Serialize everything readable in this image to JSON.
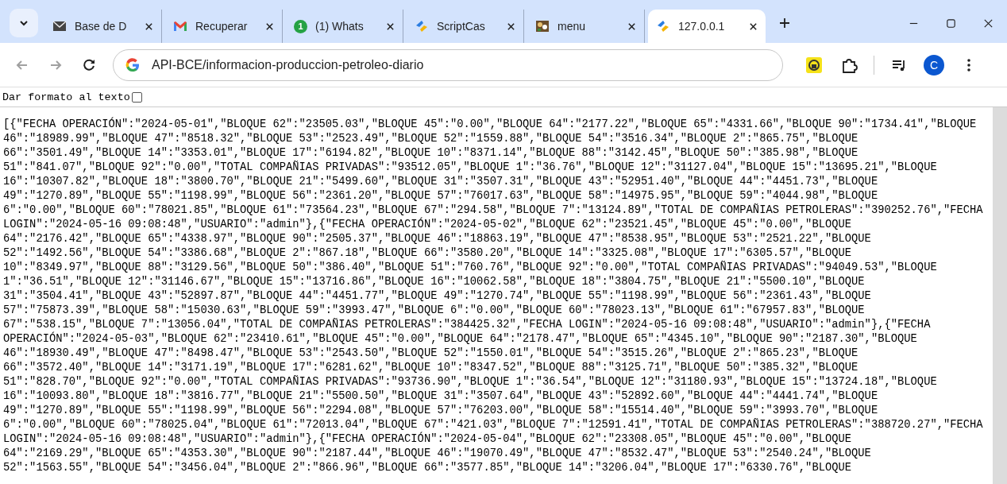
{
  "tabs": [
    {
      "kind": "mail",
      "title": "Base de D",
      "selected": false
    },
    {
      "kind": "gmail",
      "title": "Recuperar",
      "selected": false
    },
    {
      "kind": "whatsapp",
      "title": "(1) Whats",
      "badge": "1",
      "selected": false
    },
    {
      "kind": "scriptcase",
      "title": "ScriptCas",
      "selected": false
    },
    {
      "kind": "image",
      "title": "menu",
      "selected": false
    },
    {
      "kind": "scriptcase",
      "title": "127.0.0.1",
      "selected": true
    }
  ],
  "address": "API-BCE/informacion-produccion-petroleo-diario",
  "profile": "C",
  "pretty_print": {
    "label": "Dar formato al texto",
    "checked": false
  },
  "lines": [
    "[{\"FECHA OPERACIÓN\":\"2024-05-01\",\"BLOQUE 62\":\"23505.03\",\"BLOQUE 45\":\"0.00\",\"BLOQUE 64\":\"2177.22\",\"BLOQUE 65\":\"4331.66\",\"BLOQUE 90\":\"1734.41\",\"BLOQUE",
    "46\":\"18989.99\",\"BLOQUE 47\":\"8518.32\",\"BLOQUE 53\":\"2523.49\",\"BLOQUE 52\":\"1559.88\",\"BLOQUE 54\":\"3516.34\",\"BLOQUE 2\":\"865.75\",\"BLOQUE",
    "66\":\"3501.49\",\"BLOQUE 14\":\"3353.01\",\"BLOQUE 17\":\"6194.82\",\"BLOQUE 10\":\"8371.14\",\"BLOQUE 88\":\"3142.45\",\"BLOQUE 50\":\"385.98\",\"BLOQUE",
    "51\":\"841.07\",\"BLOQUE 92\":\"0.00\",\"TOTAL COMPAÑIAS PRIVADAS\":\"93512.05\",\"BLOQUE 1\":\"36.76\",\"BLOQUE 12\":\"31127.04\",\"BLOQUE 15\":\"13695.21\",\"BLOQUE",
    "16\":\"10307.82\",\"BLOQUE 18\":\"3800.70\",\"BLOQUE 21\":\"5499.60\",\"BLOQUE 31\":\"3507.31\",\"BLOQUE 43\":\"52951.40\",\"BLOQUE 44\":\"4451.73\",\"BLOQUE",
    "49\":\"1270.89\",\"BLOQUE 55\":\"1198.99\",\"BLOQUE 56\":\"2361.20\",\"BLOQUE 57\":\"76017.63\",\"BLOQUE 58\":\"14975.95\",\"BLOQUE 59\":\"4044.98\",\"BLOQUE",
    "6\":\"0.00\",\"BLOQUE 60\":\"78021.85\",\"BLOQUE 61\":\"73564.23\",\"BLOQUE 67\":\"294.58\",\"BLOQUE 7\":\"13124.89\",\"TOTAL DE COMPAÑIAS PETROLERAS\":\"390252.76\",\"FECHA",
    "LOGIN\":\"2024-05-16 09:08:48\",\"USUARIO\":\"admin\"},{\"FECHA OPERACIÓN\":\"2024-05-02\",\"BLOQUE 62\":\"23521.45\",\"BLOQUE 45\":\"0.00\",\"BLOQUE",
    "64\":\"2176.42\",\"BLOQUE 65\":\"4338.97\",\"BLOQUE 90\":\"2505.37\",\"BLOQUE 46\":\"18863.19\",\"BLOQUE 47\":\"8538.95\",\"BLOQUE 53\":\"2521.22\",\"BLOQUE",
    "52\":\"1492.56\",\"BLOQUE 54\":\"3386.68\",\"BLOQUE 2\":\"867.18\",\"BLOQUE 66\":\"3580.20\",\"BLOQUE 14\":\"3325.08\",\"BLOQUE 17\":\"6305.57\",\"BLOQUE",
    "10\":\"8349.97\",\"BLOQUE 88\":\"3129.56\",\"BLOQUE 50\":\"386.40\",\"BLOQUE 51\":\"760.76\",\"BLOQUE 92\":\"0.00\",\"TOTAL COMPAÑIAS PRIVADAS\":\"94049.53\",\"BLOQUE",
    "1\":\"36.51\",\"BLOQUE 12\":\"31146.67\",\"BLOQUE 15\":\"13716.86\",\"BLOQUE 16\":\"10062.58\",\"BLOQUE 18\":\"3804.75\",\"BLOQUE 21\":\"5500.10\",\"BLOQUE",
    "31\":\"3504.41\",\"BLOQUE 43\":\"52897.87\",\"BLOQUE 44\":\"4451.77\",\"BLOQUE 49\":\"1270.74\",\"BLOQUE 55\":\"1198.99\",\"BLOQUE 56\":\"2361.43\",\"BLOQUE",
    "57\":\"75873.39\",\"BLOQUE 58\":\"15030.63\",\"BLOQUE 59\":\"3993.47\",\"BLOQUE 6\":\"0.00\",\"BLOQUE 60\":\"78023.13\",\"BLOQUE 61\":\"67957.83\",\"BLOQUE",
    "67\":\"538.15\",\"BLOQUE 7\":\"13056.04\",\"TOTAL DE COMPAÑIAS PETROLERAS\":\"384425.32\",\"FECHA LOGIN\":\"2024-05-16 09:08:48\",\"USUARIO\":\"admin\"},{\"FECHA",
    "OPERACIÓN\":\"2024-05-03\",\"BLOQUE 62\":\"23410.61\",\"BLOQUE 45\":\"0.00\",\"BLOQUE 64\":\"2178.47\",\"BLOQUE 65\":\"4345.10\",\"BLOQUE 90\":\"2187.30\",\"BLOQUE",
    "46\":\"18930.49\",\"BLOQUE 47\":\"8498.47\",\"BLOQUE 53\":\"2543.50\",\"BLOQUE 52\":\"1550.01\",\"BLOQUE 54\":\"3515.26\",\"BLOQUE 2\":\"865.23\",\"BLOQUE",
    "66\":\"3572.40\",\"BLOQUE 14\":\"3171.19\",\"BLOQUE 17\":\"6281.62\",\"BLOQUE 10\":\"8347.52\",\"BLOQUE 88\":\"3125.71\",\"BLOQUE 50\":\"385.32\",\"BLOQUE",
    "51\":\"828.70\",\"BLOQUE 92\":\"0.00\",\"TOTAL COMPAÑIAS PRIVADAS\":\"93736.90\",\"BLOQUE 1\":\"36.54\",\"BLOQUE 12\":\"31180.93\",\"BLOQUE 15\":\"13724.18\",\"BLOQUE",
    "16\":\"10093.80\",\"BLOQUE 18\":\"3816.77\",\"BLOQUE 21\":\"5500.50\",\"BLOQUE 31\":\"3507.64\",\"BLOQUE 43\":\"52892.60\",\"BLOQUE 44\":\"4441.74\",\"BLOQUE",
    "49\":\"1270.89\",\"BLOQUE 55\":\"1198.99\",\"BLOQUE 56\":\"2294.08\",\"BLOQUE 57\":\"76203.00\",\"BLOQUE 58\":\"15514.40\",\"BLOQUE 59\":\"3993.70\",\"BLOQUE",
    "6\":\"0.00\",\"BLOQUE 60\":\"78025.04\",\"BLOQUE 61\":\"72013.04\",\"BLOQUE 67\":\"421.03\",\"BLOQUE 7\":\"12591.41\",\"TOTAL DE COMPAÑIAS PETROLERAS\":\"388720.27\",\"FECHA",
    "LOGIN\":\"2024-05-16 09:08:48\",\"USUARIO\":\"admin\"},{\"FECHA OPERACIÓN\":\"2024-05-04\",\"BLOQUE 62\":\"23308.05\",\"BLOQUE 45\":\"0.00\",\"BLOQUE",
    "64\":\"2169.29\",\"BLOQUE 65\":\"4353.30\",\"BLOQUE 90\":\"2187.44\",\"BLOQUE 46\":\"19070.49\",\"BLOQUE 47\":\"8532.47\",\"BLOQUE 53\":\"2540.24\",\"BLOQUE",
    "52\":\"1563.55\",\"BLOQUE 54\":\"3456.04\",\"BLOQUE 2\":\"866.96\",\"BLOQUE 66\":\"3577.85\",\"BLOQUE 14\":\"3206.04\",\"BLOQUE 17\":\"6330.76\",\"BLOQUE"
  ]
}
